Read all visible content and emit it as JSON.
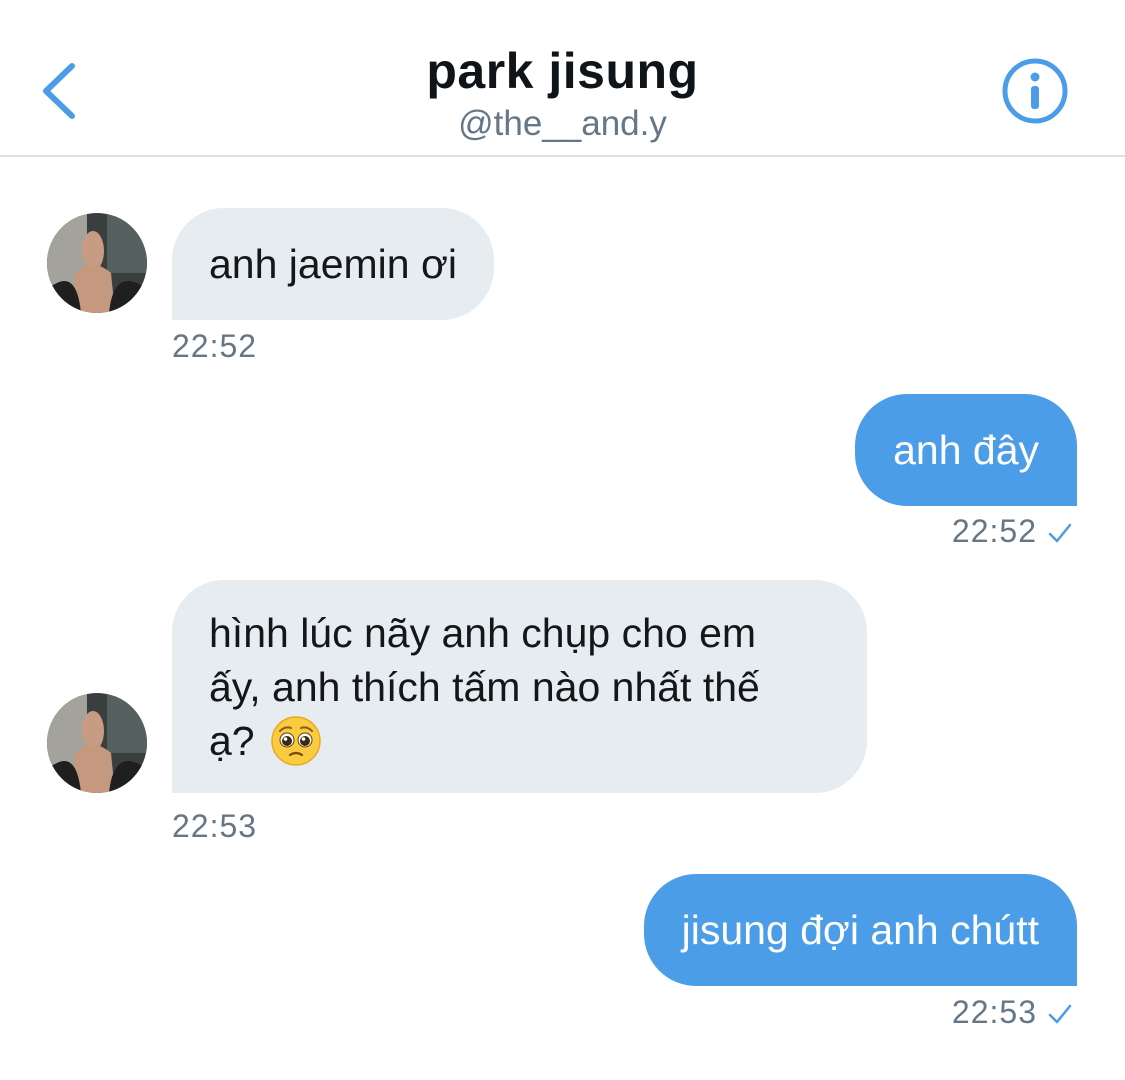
{
  "header": {
    "name": "park jisung",
    "handle": "@the__and.y",
    "back_icon": "chevron-left-icon",
    "info_icon": "info-icon"
  },
  "colors": {
    "accent": "#4c9de8",
    "incoming_bubble": "#e6ecf0",
    "secondary_text": "#657786"
  },
  "messages": [
    {
      "direction": "incoming",
      "text": "anh jaemin ơi",
      "time": "22:52"
    },
    {
      "direction": "outgoing",
      "text": "anh đây",
      "time": "22:52",
      "status_icon": "checkmark-icon"
    },
    {
      "direction": "incoming",
      "lines": [
        "hình lúc nãy anh chụp cho em",
        "ấy, anh thích tấm nào nhất thế",
        "ạ?"
      ],
      "emoji": "pleading-face-emoji",
      "time": "22:53"
    },
    {
      "direction": "outgoing",
      "text": "jisung đợi anh chútt",
      "time": "22:53",
      "status_icon": "checkmark-icon"
    }
  ]
}
